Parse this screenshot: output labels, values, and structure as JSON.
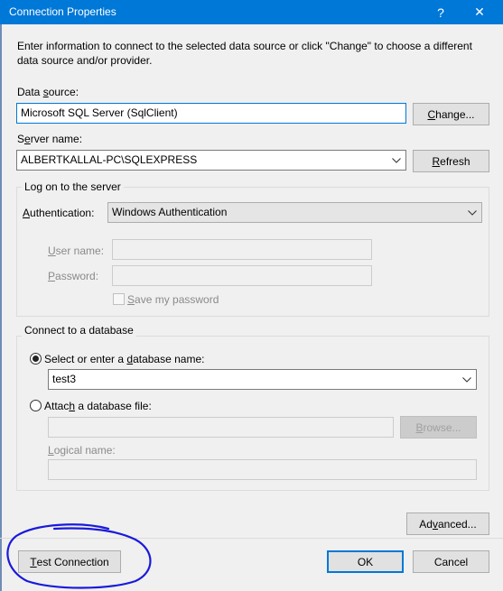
{
  "window": {
    "title": "Connection Properties",
    "help_glyph": "?",
    "close_glyph": "✕"
  },
  "intro_text": "Enter information to connect to the selected data source or click \"Change\" to choose a different data source and/or provider.",
  "data_source": {
    "label_pre": "Data ",
    "label_key": "s",
    "label_post": "ource:",
    "value": "Microsoft SQL Server (SqlClient)",
    "change_key": "C",
    "change_post": "hange..."
  },
  "server_name": {
    "label_pre": "S",
    "label_key": "e",
    "label_post": "rver name:",
    "value": "ALBERTKALLAL-PC\\SQLEXPRESS",
    "refresh_key": "R",
    "refresh_post": "efresh"
  },
  "log_on": {
    "title": "Log on to the server",
    "auth_key": "A",
    "auth_post": "uthentication:",
    "auth_value": "Windows Authentication",
    "user_key": "U",
    "user_post": "ser name:",
    "user_value": "",
    "pwd_key": "P",
    "pwd_post": "assword:",
    "pwd_value": "",
    "save_key": "S",
    "save_post": "ave my password",
    "save_checked": false
  },
  "database": {
    "title": "Connect to a database",
    "select_pre": "Select or enter a ",
    "select_key": "d",
    "select_post": "atabase name:",
    "db_value": "test3",
    "attach_pre": "Attac",
    "attach_key": "h",
    "attach_post": " a database file:",
    "attach_value": "",
    "browse_key": "B",
    "browse_post": "rowse...",
    "logical_key": "L",
    "logical_post": "ogical name:",
    "logical_value": ""
  },
  "buttons": {
    "advanced_pre": "Ad",
    "advanced_key": "v",
    "advanced_post": "anced...",
    "test_key": "T",
    "test_post": "est Connection",
    "ok": "OK",
    "cancel": "Cancel"
  },
  "colors": {
    "titlebar": "#0078d7",
    "annotation": "#1a1adb"
  }
}
